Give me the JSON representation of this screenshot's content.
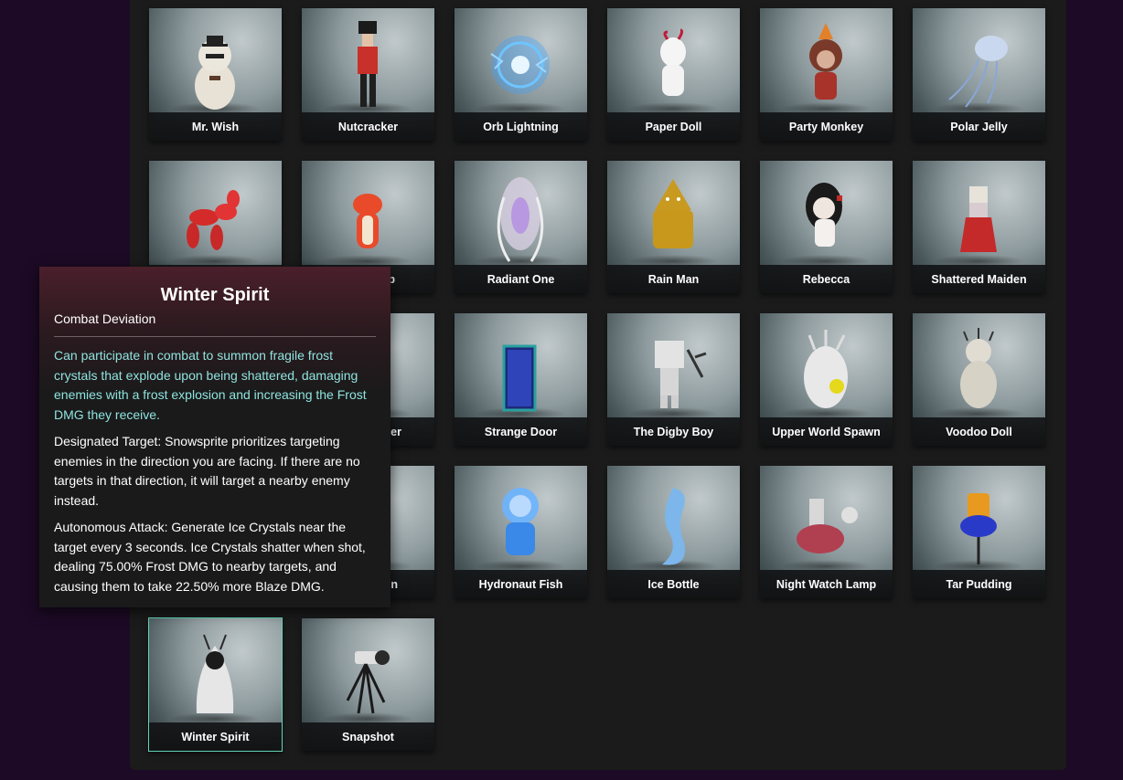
{
  "cards": [
    {
      "name": "Mr. Wish",
      "icon": "mr-wish-figure"
    },
    {
      "name": "Nutcracker",
      "icon": "nutcracker-figure"
    },
    {
      "name": "Orb Lightning",
      "icon": "orb-lightning-figure"
    },
    {
      "name": "Paper Doll",
      "icon": "paper-doll-figure"
    },
    {
      "name": "Party Monkey",
      "icon": "party-monkey-figure"
    },
    {
      "name": "Polar Jelly",
      "icon": "polar-jelly-figure"
    },
    {
      "name": "",
      "icon": "balloon-dog-figure"
    },
    {
      "name": "p",
      "icon": "red-dino-figure"
    },
    {
      "name": "Radiant One",
      "icon": "radiant-one-figure"
    },
    {
      "name": "Rain Man",
      "icon": "rain-man-figure"
    },
    {
      "name": "Rebecca",
      "icon": "rebecca-figure"
    },
    {
      "name": "Shattered Maiden",
      "icon": "shattered-maiden-figure"
    },
    {
      "name": "",
      "icon": "hidden-figure"
    },
    {
      "name": "er",
      "icon": "hidden-figure"
    },
    {
      "name": "Strange Door",
      "icon": "strange-door-figure"
    },
    {
      "name": "The Digby Boy",
      "icon": "digby-boy-figure"
    },
    {
      "name": "Upper World Spawn",
      "icon": "upper-world-spawn-figure"
    },
    {
      "name": "Voodoo Doll",
      "icon": "voodoo-doll-figure"
    },
    {
      "name": "",
      "icon": "hidden-figure"
    },
    {
      "name": "n",
      "icon": "hidden-figure"
    },
    {
      "name": "Hydronaut Fish",
      "icon": "hydronaut-fish-figure"
    },
    {
      "name": "Ice Bottle",
      "icon": "ice-bottle-figure"
    },
    {
      "name": "Night Watch Lamp",
      "icon": "night-watch-lamp-figure"
    },
    {
      "name": "Tar Pudding",
      "icon": "tar-pudding-figure"
    },
    {
      "name": "Winter Spirit",
      "icon": "winter-spirit-figure",
      "selected": true
    },
    {
      "name": "Snapshot",
      "icon": "snapshot-figure"
    }
  ],
  "tooltip": {
    "title": "Winter Spirit",
    "subtitle": "Combat Deviation",
    "description": "Can participate in combat to summon fragile frost crystals that explode upon being shattered, damaging enemies with a frost explosion and increasing the Frost DMG they receive.",
    "paragraph1": "Designated Target: Snowsprite prioritizes targeting enemies in the direction you are facing. If there are no targets in that direction, it will target a nearby enemy instead.",
    "paragraph2": "Autonomous Attack: Generate Ice Crystals near the target every 3 seconds. Ice Crystals shatter when shot, dealing 75.00% Frost DMG to nearby targets, and causing them to take 22.50% more Blaze DMG."
  },
  "colors": {
    "background": "#1d0a26",
    "panel": "#1b1b1b",
    "selected_outline": "#62d4b9",
    "description_text": "#8fe3df"
  }
}
